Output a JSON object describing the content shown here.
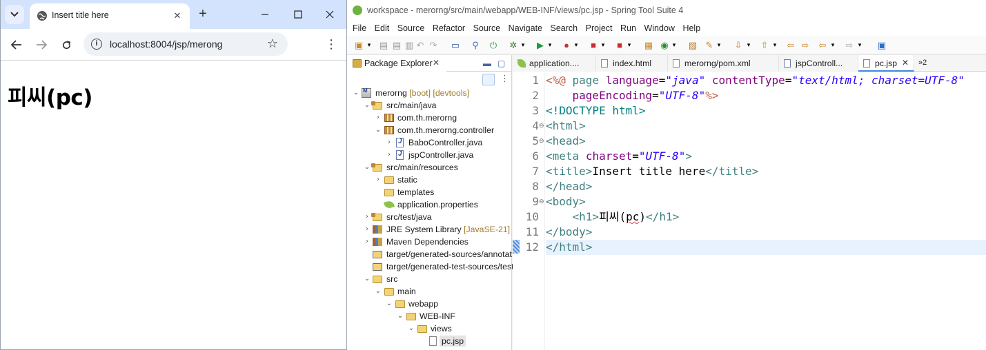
{
  "browser": {
    "tab_title": "Insert title here",
    "url": "localhost:8004/jsp/merong",
    "page_heading": "피씨(pc)"
  },
  "ide": {
    "window_title": "workspace - merorng/src/main/webapp/WEB-INF/views/pc.jsp - Spring Tool Suite 4",
    "menu": [
      "File",
      "Edit",
      "Source",
      "Refactor",
      "Source",
      "Navigate",
      "Search",
      "Project",
      "Run",
      "Window",
      "Help"
    ],
    "package_explorer": {
      "title": "Package Explorer",
      "tree": [
        {
          "label": "merorng",
          "decoration": "[boot] [devtools]",
          "icon": "project-icon"
        },
        {
          "label": "src/main/java",
          "decoration": "",
          "icon": "source-folder-icon"
        },
        {
          "label": "com.th.merorng",
          "decoration": "",
          "icon": "package-icon"
        },
        {
          "label": "com.th.merorng.controller",
          "decoration": "",
          "icon": "package-icon"
        },
        {
          "label": "BaboController.java",
          "decoration": "",
          "icon": "java-file-icon"
        },
        {
          "label": "jspController.java",
          "decoration": "",
          "icon": "java-file-icon"
        },
        {
          "label": "src/main/resources",
          "decoration": "",
          "icon": "source-folder-icon"
        },
        {
          "label": "static",
          "decoration": "",
          "icon": "folder-icon"
        },
        {
          "label": "templates",
          "decoration": "",
          "icon": "folder-icon"
        },
        {
          "label": "application.properties",
          "decoration": "",
          "icon": "properties-file-icon"
        },
        {
          "label": "src/test/java",
          "decoration": "",
          "icon": "source-folder-icon"
        },
        {
          "label": "JRE System Library",
          "decoration": "[JavaSE-21]",
          "icon": "library-icon"
        },
        {
          "label": "Maven Dependencies",
          "decoration": "",
          "icon": "library-icon"
        },
        {
          "label": "target/generated-sources/annotat",
          "decoration": "",
          "icon": "generated-folder-icon"
        },
        {
          "label": "target/generated-test-sources/test",
          "decoration": "",
          "icon": "generated-folder-icon"
        },
        {
          "label": "src",
          "decoration": "",
          "icon": "folder-icon"
        },
        {
          "label": "main",
          "decoration": "",
          "icon": "folder-icon"
        },
        {
          "label": "webapp",
          "decoration": "",
          "icon": "folder-icon"
        },
        {
          "label": "WEB-INF",
          "decoration": "",
          "icon": "folder-icon"
        },
        {
          "label": "views",
          "decoration": "",
          "icon": "folder-icon"
        },
        {
          "label": "pc.jsp",
          "decoration": "",
          "icon": "jsp-file-icon"
        }
      ]
    },
    "editor_tabs": [
      {
        "label": "application...."
      },
      {
        "label": "index.html"
      },
      {
        "label": "merorng/pom.xml"
      },
      {
        "label": "jspControll..."
      },
      {
        "label": "pc.jsp"
      }
    ],
    "overflow_tabs": "»2",
    "line_numbers": [
      "1",
      "2",
      "3",
      "4",
      "5",
      "6",
      "7",
      "8",
      "9",
      "10",
      "11",
      "12"
    ],
    "code": {
      "l1_open": "<%@",
      "l1_page": " page ",
      "l1_lang_attr": "language",
      "l1_lang_val": "\"java\"",
      "l1_ct_attr": "contentType",
      "l1_ct_val": "\"text/html; charset=UTF-8\"",
      "l2_attr": "pageEncoding",
      "l2_val": "\"UTF-8\"",
      "l2_close": "%>",
      "l3": "<!DOCTYPE html>",
      "l4": "<html>",
      "l5": "<head>",
      "l6_tag": "<meta",
      "l6_attr": "charset",
      "l6_val": "\"UTF-8\"",
      "l6_end": ">",
      "l7_open": "<title>",
      "l7_text": "Insert title here",
      "l7_close": "</title>",
      "l8": "</head>",
      "l9": "<body>",
      "l10_open": "<h1>",
      "l10_text_a": "피씨(",
      "l10_text_b": "pc",
      "l10_text_c": ")",
      "l10_close": "</h1>",
      "l11": "</body>",
      "l12": "</html>"
    }
  }
}
